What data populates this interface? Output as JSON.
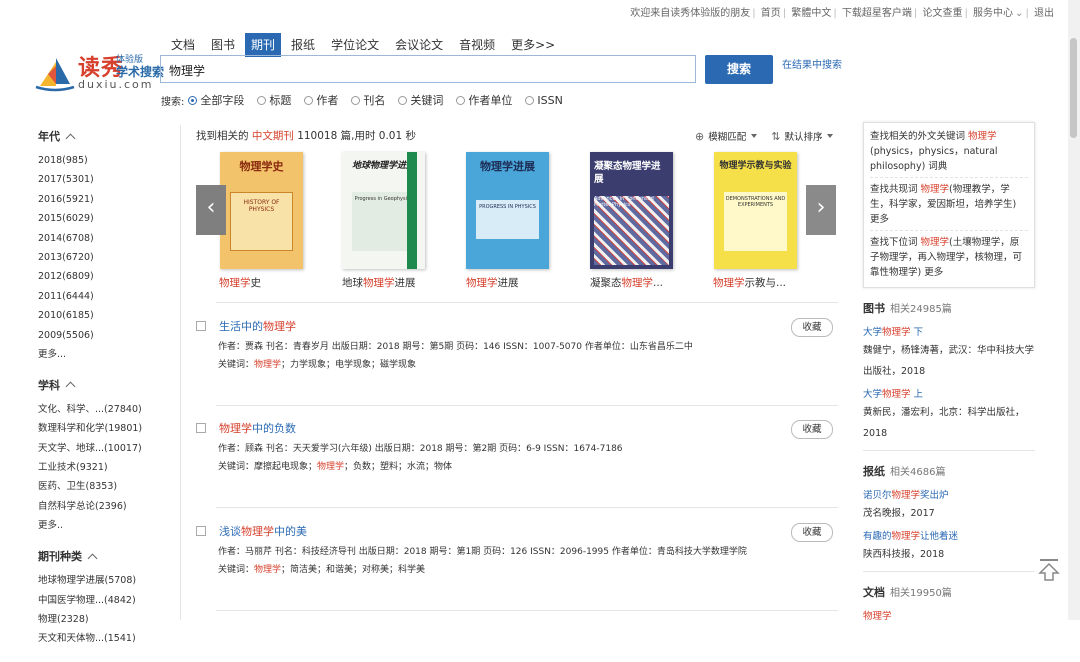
{
  "topbar": {
    "items": [
      "欢迎来自读秀体验版的朋友",
      "首页",
      "繁體中文",
      "下载超星客户端",
      "论文查重",
      "服务中心",
      "退出"
    ]
  },
  "logo": {
    "brand": "读秀",
    "sub": "体验版",
    "sub2": "学术搜索",
    "url": "duxiu.com"
  },
  "nav": {
    "tabs": [
      "文档",
      "图书",
      "期刊",
      "报纸",
      "学位论文",
      "会议论文",
      "音视频",
      "更多>>"
    ],
    "active": "期刊"
  },
  "search": {
    "query": "物理学",
    "button": "搜索",
    "in_results": "在结果中搜索"
  },
  "fields": {
    "label": "搜索:",
    "options": [
      "全部字段",
      "标题",
      "作者",
      "刊名",
      "关键词",
      "作者单位",
      "ISSN"
    ],
    "selected": "全部字段"
  },
  "sidebar": {
    "groups": [
      {
        "title": "年代",
        "items": [
          "2018(985)",
          "2017(5301)",
          "2016(5921)",
          "2015(6029)",
          "2014(6708)",
          "2013(6720)",
          "2012(6809)",
          "2011(6444)",
          "2010(6185)",
          "2009(5506)"
        ],
        "more": "更多..."
      },
      {
        "title": "学科",
        "items": [
          "文化、科学、...(27840)",
          "数理科学和化学(19801)",
          "天文学、地球...(10017)",
          "工业技术(9321)",
          "医药、卫生(8353)",
          "自然科学总论(2396)"
        ],
        "more": "更多.."
      },
      {
        "title": "期刊种类",
        "items": [
          "地球物理学进展(5708)",
          "中国医学物理...(4842)",
          "物理(2328)",
          "天文和天体物...(1541)"
        ],
        "more": ""
      }
    ]
  },
  "results_info": {
    "prefix": "找到相关的",
    "type": "中文期刊",
    "suffix": "110018 篇,用时 0.01 秒"
  },
  "sort": {
    "match": "模糊匹配",
    "order": "默认排序"
  },
  "carousel": [
    {
      "caption_hl": "物理学",
      "caption_rest": "史",
      "cover_title": "物理学史",
      "cover_sub": "HISTORY OF PHYSICS",
      "bg": "#f2c36a",
      "fg": "#8b2a10"
    },
    {
      "caption_pre": "地球",
      "caption_hl": "物理学",
      "caption_rest": "进展",
      "cover_title": "地球物理学进展",
      "cover_sub": "Progress in Geophysics",
      "bg": "#f4f6f2",
      "fg": "#222222"
    },
    {
      "caption_hl": "物理学",
      "caption_rest": "进展",
      "cover_title": "物理学进展",
      "cover_sub": "PROGRESS IN PHYSICS",
      "bg": "#4aa6d9",
      "fg": "#1d2c55"
    },
    {
      "caption_pre": "凝聚态",
      "caption_hl": "物理学",
      "caption_rest": "...",
      "cover_title": "凝聚态物理学进展",
      "cover_sub": "Advances in Condensed Matter Physics",
      "bg": "#3a3d6e",
      "fg": "#ffffff"
    },
    {
      "caption_hl": "物理学",
      "caption_rest": "示教与...",
      "cover_title": "物理学示教与实验",
      "cover_sub": "DEMONSTRATIONS AND EXPERIMENTS",
      "bg": "#f5e04a",
      "fg": "#333333"
    }
  ],
  "results": [
    {
      "title_pre": "生活中的",
      "title_hl": "物理学",
      "title_post": "",
      "meta": "作者：贾森  刊名：青春岁月  出版日期：2018  期号：第5期  页码：146  ISSN：1007-5070  作者单位：山东省昌乐二中",
      "kw_label": "关键词：",
      "kw_hl": "物理学",
      "kw_rest": "；力学现象；电学现象；磁学现象",
      "collect": "收藏"
    },
    {
      "title_pre": "",
      "title_hl": "物理学",
      "title_post": "中的负数",
      "meta": "作者：顾森  刊名：天天爱学习(六年级)  出版日期：2018  期号：第2期  页码：6-9  ISSN：1674-7186",
      "kw_label": "关键词：摩擦起电现象；",
      "kw_hl": "物理学",
      "kw_rest": "；负数；塑料；水流；物体",
      "collect": "收藏"
    },
    {
      "title_pre": "浅谈",
      "title_hl": "物理学",
      "title_post": "中的美",
      "meta": "作者：马丽芹  刊名：科技经济导刊  出版日期：2018  期号：第1期  页码：126  ISSN：2096-1995  作者单位：青岛科技大学数理学院",
      "kw_label": "关键词：",
      "kw_hl": "物理学",
      "kw_rest": "；简洁美；和谐美；对称美；科学美",
      "collect": "收藏"
    }
  ],
  "right": {
    "hints": [
      {
        "pre": "查找相关的外文关键词 ",
        "hl": "物理学",
        "rest": "(physics，physics，natural philosophy) 词典"
      },
      {
        "pre": "查找共现词 ",
        "hl": "物理学",
        "rest": "(物理教学，学生，科学家，爱因斯坦，培养学生) 更多"
      },
      {
        "pre": "查找下位词 ",
        "hl": "物理学",
        "rest": "(土壤物理学，原子物理学，再入物理学，核物理，可靠性物理学) 更多"
      }
    ],
    "books": {
      "title": "图书",
      "count": "相关24985篇",
      "items": [
        {
          "pre": "大学",
          "hl": "物理学",
          "post": " 下",
          "desc": "魏健宁，杨锋涛著，武汉：华中科技大学出版社，2018"
        },
        {
          "pre": "大学",
          "hl": "物理学",
          "post": " 上",
          "desc": "黄新民，潘宏利，北京：科学出版社，2018"
        }
      ]
    },
    "papers": {
      "title": "报纸",
      "count": "相关4686篇",
      "items": [
        {
          "pre": "诺贝尔",
          "hl": "物理学",
          "post": "奖出炉",
          "desc": "茂名晚报，2017"
        },
        {
          "pre": "有趣的",
          "hl": "物理学",
          "post": "让他着迷",
          "desc": "陕西科技报，2018"
        }
      ]
    },
    "docs": {
      "title": "文档",
      "count": "相关19950篇",
      "items": [
        {
          "pre": "",
          "hl": "物理学",
          "post": "",
          "desc": ""
        }
      ]
    }
  },
  "colors": {
    "accent": "#2b6ab3",
    "highlight": "#d6402c"
  }
}
